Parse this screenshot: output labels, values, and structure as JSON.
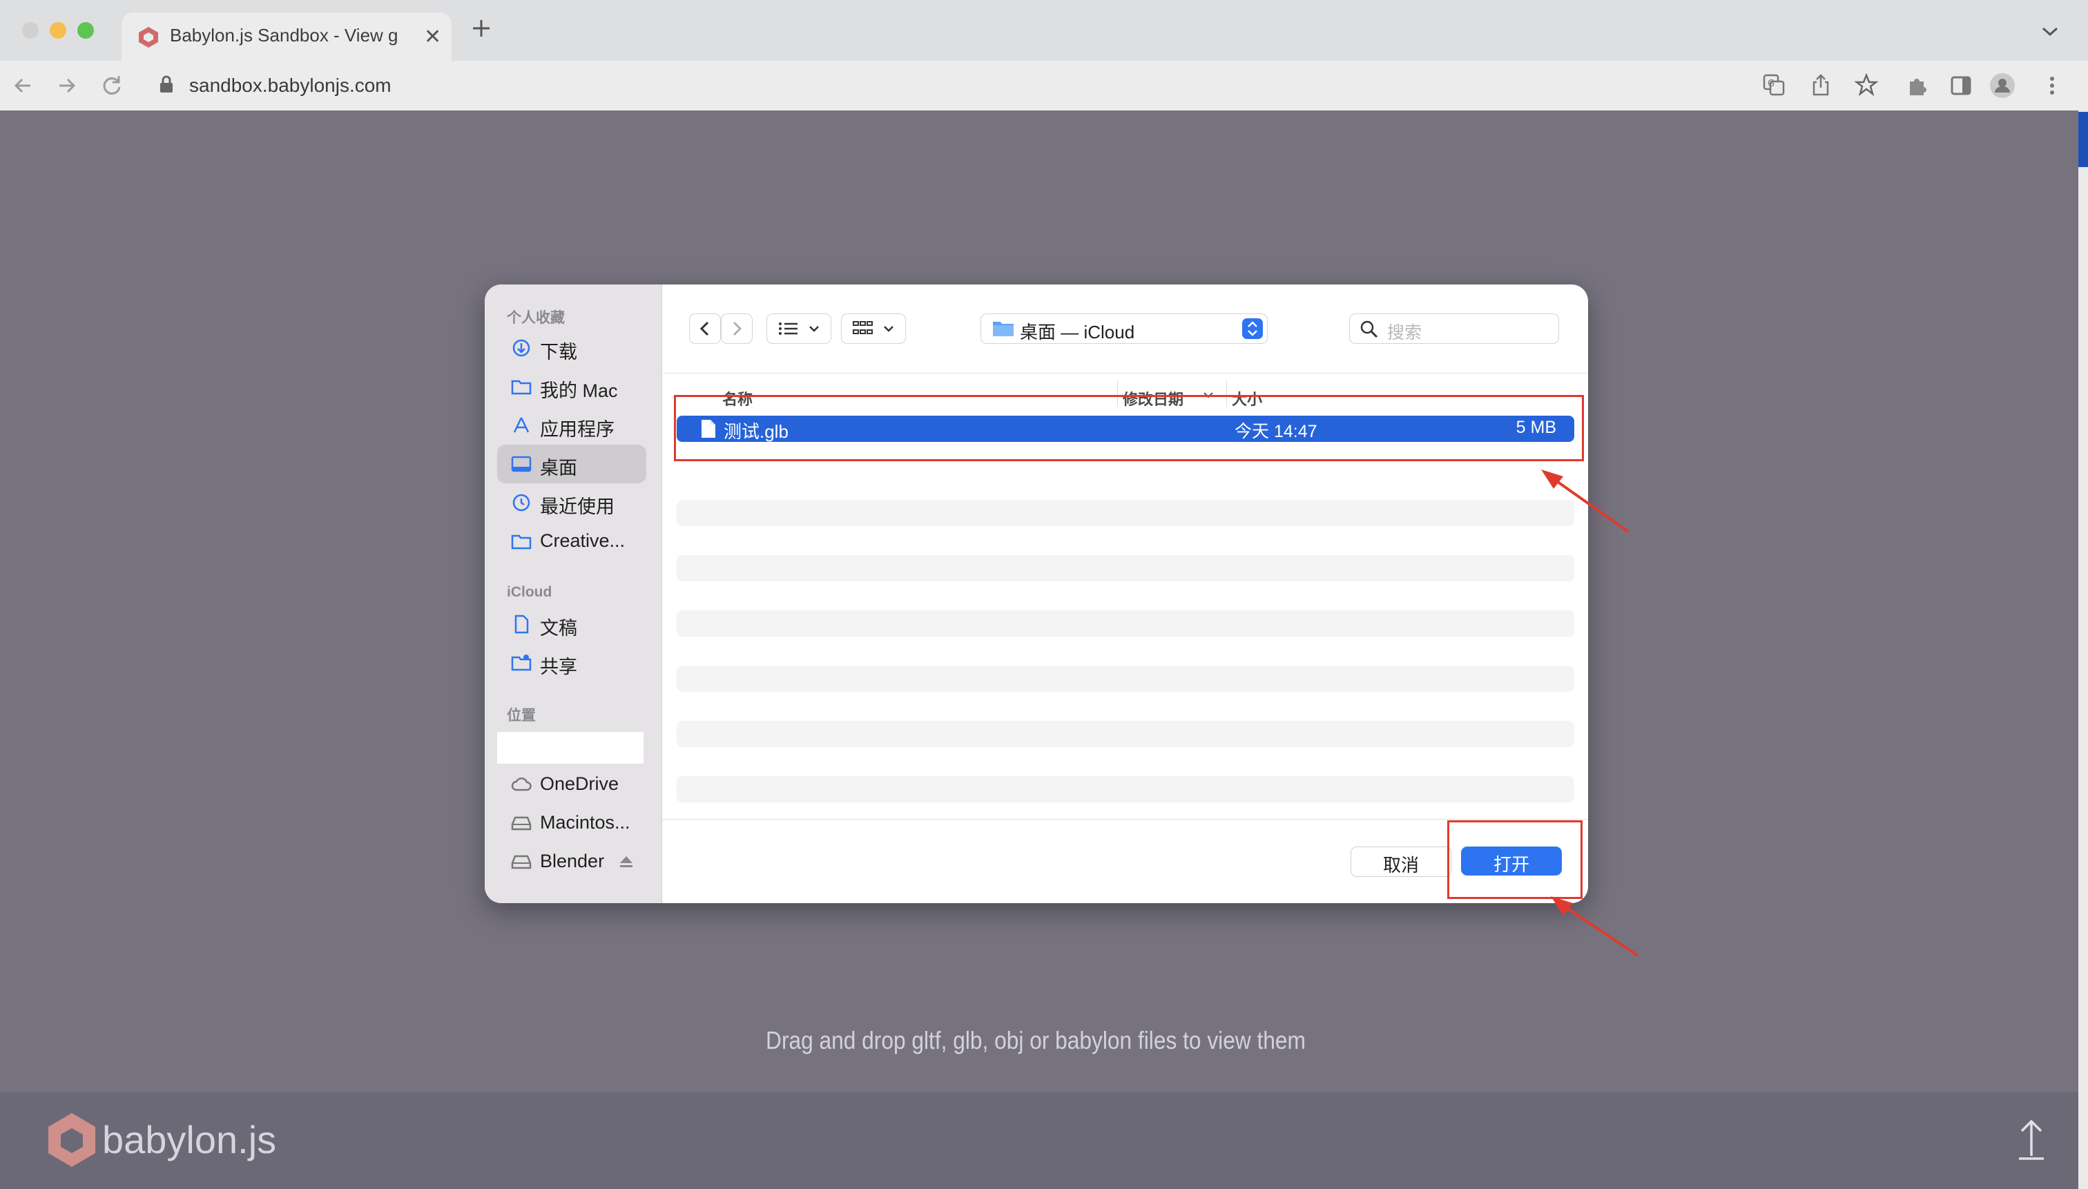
{
  "browser": {
    "tab_title": "Babylon.js Sandbox - View glTF",
    "url": "sandbox.babylonjs.com"
  },
  "page": {
    "drop_message": "Drag and drop gltf, glb, obj or babylon files to view them",
    "logo_text": "babylon.js"
  },
  "dialog": {
    "sidebar": {
      "favorites_header": "个人收藏",
      "favorites": [
        {
          "label": "下载",
          "icon": "download-icon"
        },
        {
          "label": "我的 Mac",
          "icon": "folder-icon"
        },
        {
          "label": "应用程序",
          "icon": "apps-icon"
        },
        {
          "label": "桌面",
          "icon": "desktop-icon",
          "selected": true
        },
        {
          "label": "最近使用",
          "icon": "clock-icon"
        },
        {
          "label": "Creative...",
          "icon": "folder-icon"
        }
      ],
      "icloud_header": "iCloud",
      "icloud": [
        {
          "label": "文稿",
          "icon": "document-icon"
        },
        {
          "label": "共享",
          "icon": "shared-folder-icon"
        }
      ],
      "locations_header": "位置",
      "locations": [
        {
          "label": "OneDrive",
          "icon": "cloud-icon"
        },
        {
          "label": "Macintos...",
          "icon": "disk-icon"
        },
        {
          "label": "Blender",
          "icon": "disk-icon"
        }
      ]
    },
    "path_label": "桌面 — iCloud",
    "search_placeholder": "搜索",
    "columns": {
      "name": "名称",
      "date": "修改日期",
      "size": "大小"
    },
    "files": [
      {
        "name": "测试.glb",
        "date": "今天 14:47",
        "size": "5 MB",
        "selected": true
      }
    ],
    "cancel_label": "取消",
    "open_label": "打开"
  },
  "colors": {
    "accent": "#2d74f0",
    "selection": "#2663d9",
    "annotation_red": "#e03a2f"
  }
}
